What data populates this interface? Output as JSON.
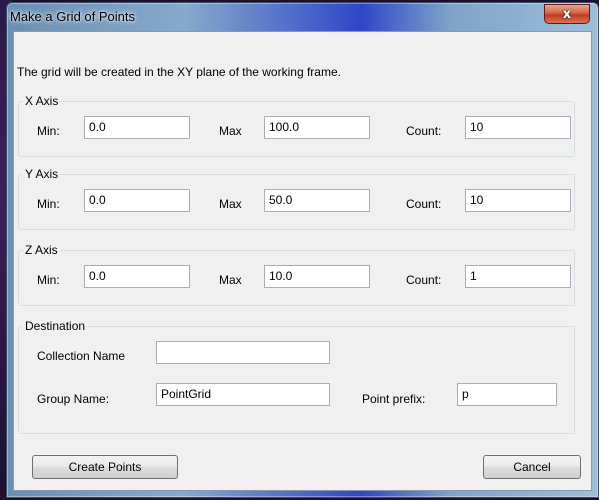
{
  "window": {
    "title": "Make a Grid of Points",
    "close_symbol": "x"
  },
  "intro": "The grid will be created in the XY plane of the working frame.",
  "labels": {
    "min": "Min:",
    "max": "Max",
    "count": "Count:"
  },
  "x_axis": {
    "title": "X Axis",
    "min": "0.0",
    "max": "100.0",
    "count": "10"
  },
  "y_axis": {
    "title": "Y Axis",
    "min": "0.0",
    "max": "50.0",
    "count": "10"
  },
  "z_axis": {
    "title": "Z Axis",
    "min": "0.0",
    "max": "10.0",
    "count": "1"
  },
  "destination": {
    "title": "Destination",
    "collection_label": "Collection Name",
    "collection_value": "",
    "group_label": "Group Name:",
    "group_value": "PointGrid",
    "prefix_label": "Point prefix:",
    "prefix_value": "p"
  },
  "buttons": {
    "create": "Create Points",
    "cancel": "Cancel"
  }
}
